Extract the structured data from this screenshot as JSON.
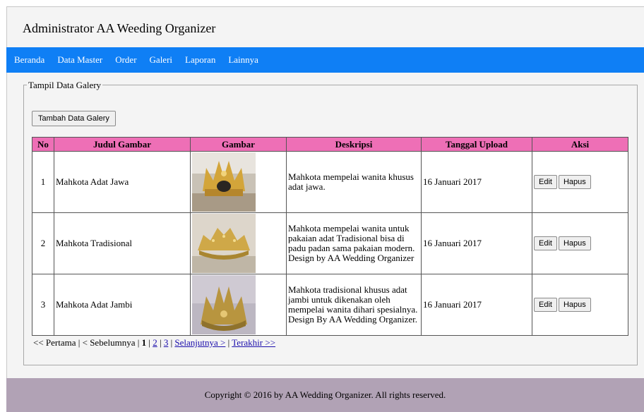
{
  "app": {
    "title": "Administrator AA Weeding Organizer"
  },
  "nav": {
    "items": [
      "Beranda",
      "Data Master",
      "Order",
      "Galeri",
      "Laporan",
      "Lainnya"
    ]
  },
  "section": {
    "legend": "Tampil Data Galery",
    "add_button": "Tambah Data Galery"
  },
  "table": {
    "headers": [
      "No",
      "Judul Gambar",
      "Gambar",
      "Deskripsi",
      "Tanggal Upload",
      "Aksi"
    ],
    "rows": [
      {
        "no": "1",
        "title": "Mahkota Adat Jawa",
        "description": "Mahkota mempelai wanita khusus adat jawa.",
        "date": "16 Januari 2017"
      },
      {
        "no": "2",
        "title": "Mahkota Tradisional",
        "description": "Mahkota mempelai wanita untuk pakaian adat Tradisional bisa di padu padan sama pakaian modern. Design by AA Wedding Organizer",
        "date": "16 Januari 2017"
      },
      {
        "no": "3",
        "title": "Mahkota Adat Jambi",
        "description": "Mahkota tradisional khusus adat jambi untuk dikenakan oleh mempelai wanita dihari spesialnya. Design By AA Wedding Organizer.",
        "date": "16 Januari 2017"
      }
    ],
    "edit_label": "Edit",
    "delete_label": "Hapus"
  },
  "pagination": {
    "first": "<< Pertama",
    "prev": "< Sebelumnya",
    "pages": [
      "1",
      "2",
      "3"
    ],
    "next": "Selanjutnya >",
    "last": "Terakhir >>"
  },
  "footer": {
    "text": "Copyright © 2016 by AA Wedding Organizer. All rights reserved."
  }
}
